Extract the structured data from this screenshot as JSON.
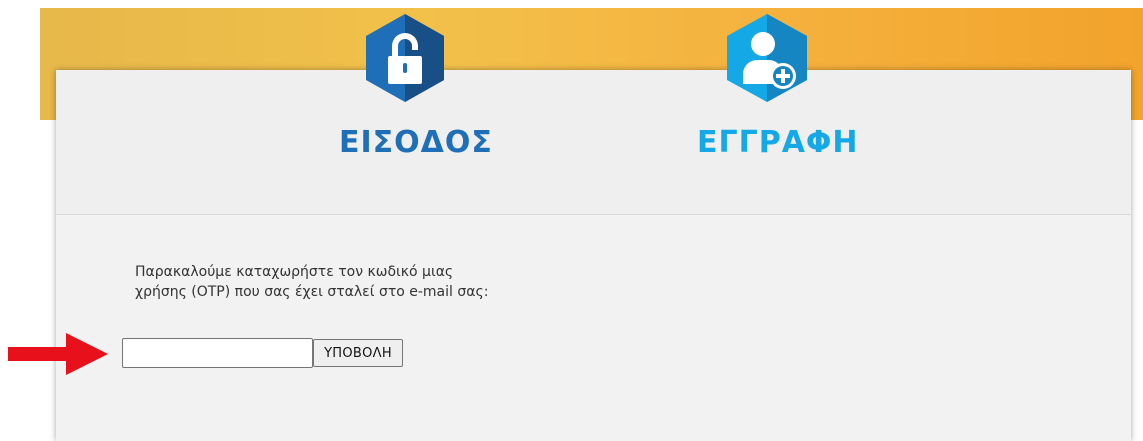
{
  "tabs": [
    {
      "label": "ΕΙΣΟΔΟΣ",
      "icon": "unlock-icon",
      "color": "#1f6fb8",
      "shade": "#184f86"
    },
    {
      "label": "ΕΓΓΡΑΦΗ",
      "icon": "add-user-icon",
      "color": "#14a9e6",
      "shade": "#1586c2"
    }
  ],
  "form": {
    "instruction_line1": "Παρακαλούμε καταχωρήστε τον κωδικό μιας",
    "instruction_line2": "χρήσης (OTP) που σας έχει σταλεί στο e-mail σας:",
    "otp_value": "",
    "otp_placeholder": "",
    "submit_label": "ΥΠΟΒΟΛΗ"
  },
  "annotation": {
    "icon": "arrow-right-icon",
    "color": "#e8101a"
  },
  "colors": {
    "banner": "#f2b23e",
    "panel": "#f2f2f2"
  }
}
